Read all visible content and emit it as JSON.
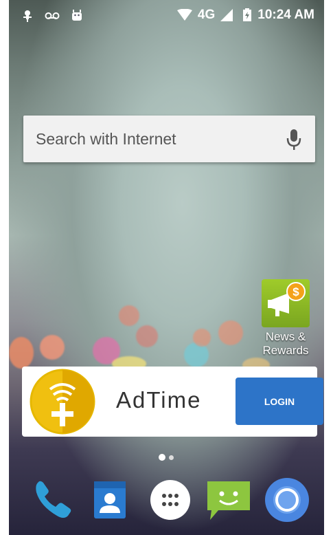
{
  "status_bar": {
    "network": "4G",
    "time": "10:24 AM",
    "icons": [
      "pin-icon",
      "voicemail-icon",
      "android-icon",
      "wifi-icon",
      "signal-icon",
      "battery-icon"
    ]
  },
  "search": {
    "placeholder": "Search with Internet",
    "icon": "mic-icon"
  },
  "home_apps": [
    {
      "label": "News & Rewards",
      "icon": "megaphone-dollar-icon"
    }
  ],
  "ad_banner": {
    "brand": "AdTime",
    "login_label": "LOGIN",
    "accent": "#2d74c8",
    "logo_color": "#f2c200"
  },
  "page_indicator": {
    "pages": 2,
    "current": 1
  },
  "dock": [
    {
      "name": "phone",
      "icon": "phone-icon"
    },
    {
      "name": "contacts",
      "icon": "contacts-icon"
    },
    {
      "name": "all-apps",
      "icon": "app-drawer-icon"
    },
    {
      "name": "messaging",
      "icon": "messaging-icon"
    },
    {
      "name": "browser",
      "icon": "chrome-icon"
    }
  ]
}
